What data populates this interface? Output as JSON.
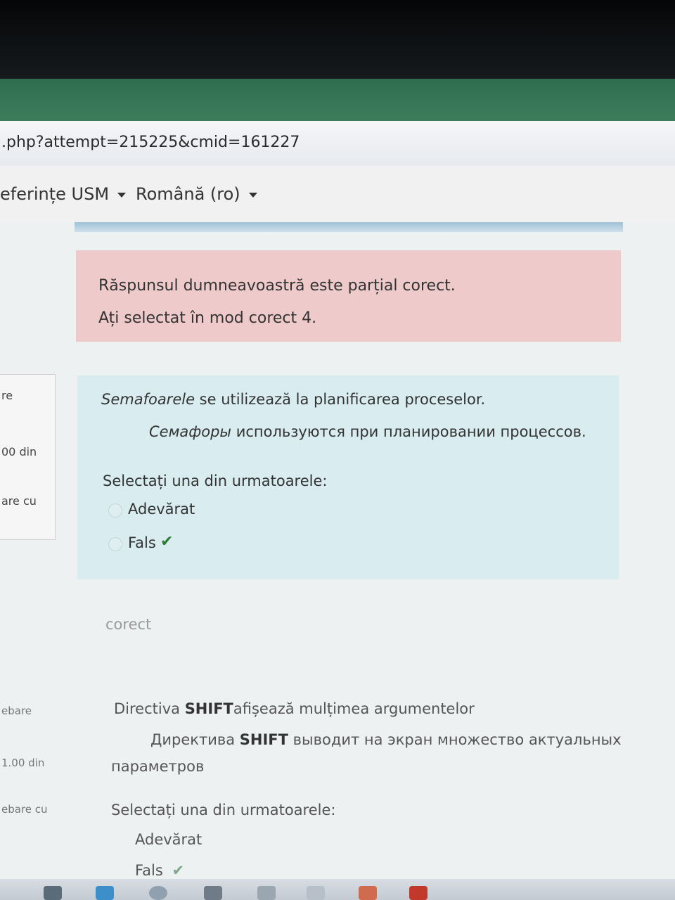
{
  "browser": {
    "url": ".php?attempt=215225&cmid=161227"
  },
  "topnav": {
    "items": [
      {
        "label": "eferințe USM"
      },
      {
        "label": "Română (ro)"
      }
    ]
  },
  "feedback": {
    "line1": "Răspunsul dumneavoastră este parțial corect.",
    "line2": "Ați selectat în mod corect 4."
  },
  "question1": {
    "info": [
      "re",
      "00 din",
      "are cu"
    ],
    "text_italic": "Semafoarele",
    "text_rest": " se utilizează la planificarea proceselor.",
    "ru_italic": "Семафоры",
    "ru_rest": " используются при планировании процессов.",
    "prompt": "Selectați una din urmatoarele:",
    "options": [
      {
        "label": "Adevărat",
        "correct": false
      },
      {
        "label": "Fals",
        "correct": true
      }
    ],
    "check_icon": "✔"
  },
  "result": "corect",
  "question2": {
    "info": [
      "ebare",
      "1.00 din",
      "ebare cu"
    ],
    "text_pre": "Directiva ",
    "text_bold": "SHIFT",
    "text_post": "afișează mulțimea argumentelor",
    "ru_pre": "Директива ",
    "ru_bold": "SHIFT",
    "ru_post_line1": " выводит на экран множество актуальных",
    "ru_post_line2": "параметров",
    "prompt": "Selectați una din urmatoarele:",
    "options": [
      {
        "label": "Adevărat"
      },
      {
        "label": "Fals"
      }
    ],
    "check_icon": "✔"
  },
  "colors": {
    "feedback_bg": "#efcaca",
    "question_bg": "#d9ecef",
    "check": "#2e7d32"
  }
}
